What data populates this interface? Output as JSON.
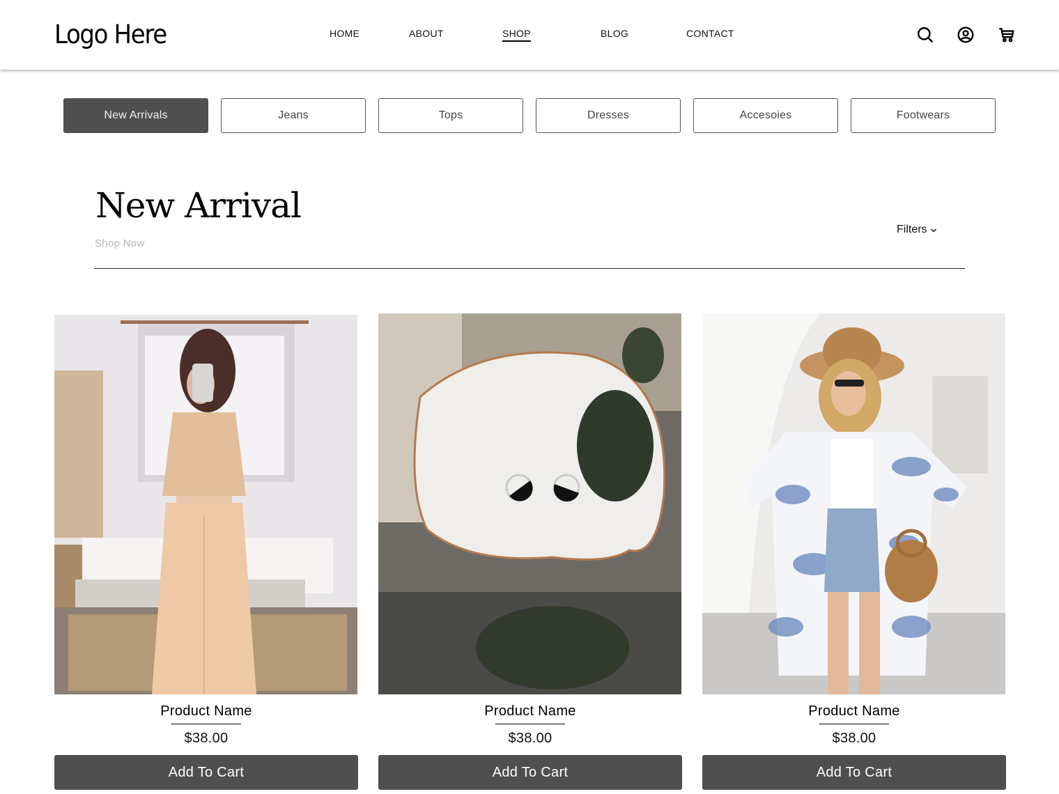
{
  "header": {
    "logo": "Logo Here",
    "nav": [
      {
        "label": "HOME",
        "active": false
      },
      {
        "label": "ABOUT",
        "active": false
      },
      {
        "label": "SHOP",
        "active": true
      },
      {
        "label": "BLOG",
        "active": false
      },
      {
        "label": "CONTACT",
        "active": false
      }
    ],
    "icons": [
      "search-icon",
      "user-account-icon",
      "shopping-cart-icon"
    ]
  },
  "categories": [
    {
      "label": "New Arrivals",
      "active": true
    },
    {
      "label": "Jeans",
      "active": false
    },
    {
      "label": "Tops",
      "active": false
    },
    {
      "label": "Dresses",
      "active": false
    },
    {
      "label": "Accesoies",
      "active": false
    },
    {
      "label": "Footwears",
      "active": false
    }
  ],
  "section": {
    "title": "New Arrival",
    "subtitle": "Shop Now",
    "filters_label": "Filters"
  },
  "products": [
    {
      "name": "Product Name",
      "price": "$38.00",
      "button": "Add To Cart",
      "image": "woman in beige crop top and wide-leg pants taking mirror selfie"
    },
    {
      "name": "Product Name",
      "price": "$38.00",
      "button": "Add To Cart",
      "image": "silver and black circle stud earrings on white ceramic shell dish"
    },
    {
      "name": "Product Name",
      "price": "$38.00",
      "button": "Add To Cart",
      "image": "woman in straw hat, sunglasses and blue floral kimono with rattan bag"
    }
  ],
  "colors": {
    "button_dark": "#4f4f4f",
    "muted_text": "#b5b5b5",
    "text": "#111111"
  }
}
